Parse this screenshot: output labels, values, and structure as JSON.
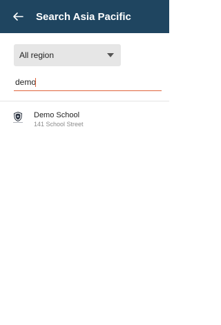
{
  "header": {
    "back_icon": "arrow-left-icon",
    "title": "Search Asia Pacific",
    "background_color": "#1f4560"
  },
  "filters": {
    "region_selected": "All region",
    "dropdown_icon": "caret-down-icon"
  },
  "search": {
    "value": "demo",
    "accent_color": "#e0643c"
  },
  "results": [
    {
      "name": "Demo School",
      "address": "141 School Street",
      "logo_icon": "school-shield-logo"
    }
  ]
}
